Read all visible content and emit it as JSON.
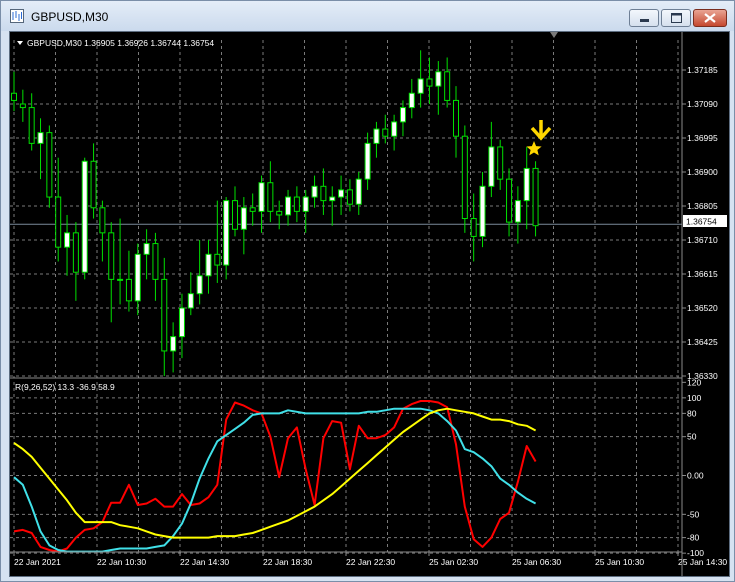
{
  "window": {
    "title": "GBPUSD,M30",
    "icon": "chart-window-icon",
    "buttons": [
      "minimize-icon",
      "maximize-icon",
      "close-icon"
    ]
  },
  "colors": {
    "background": "#000000",
    "grid": "#7a7a7a",
    "candle_up_fill": "#ffffff",
    "candle_down_fill": "#000000",
    "candle_wick": "#00e000",
    "price_line": "#7a8a9a",
    "red_line": "#ff0000",
    "cyan_line": "#40e0e8",
    "yellow_line": "#ffff00",
    "arrow": "#ffd700"
  },
  "price_chart": {
    "header": "GBPUSD,M30  1.36905 1.36926 1.36744 1.36754",
    "price_levels": [
      "1.37185",
      "1.37090",
      "1.36995",
      "1.36900",
      "1.36805",
      "1.36710",
      "1.36615",
      "1.36520",
      "1.36425",
      "1.36330"
    ],
    "current_price": "1.36754"
  },
  "indicator": {
    "header": "R(9,26,52) 13.3 -36.9 58.9",
    "levels": [
      "120",
      "100",
      "80",
      "50",
      "0.00",
      "-50",
      "-80",
      "-100"
    ]
  },
  "time_axis": [
    "22 Jan 2021",
    "22 Jan 10:30",
    "22 Jan 14:30",
    "22 Jan 18:30",
    "22 Jan 22:30",
    "25 Jan 02:30",
    "25 Jan 06:30",
    "25 Jan 10:30",
    "25 Jan 14:30"
  ],
  "chart_data": {
    "type": "candlestick",
    "symbol": "GBPUSD",
    "timeframe": "M30",
    "ylim": [
      1.363,
      1.3732
    ],
    "indicator_ylim": [
      -100,
      120
    ],
    "candles": [
      [
        1.3712,
        1.3718,
        1.3707,
        1.371
      ],
      [
        1.3709,
        1.3713,
        1.3704,
        1.3708
      ],
      [
        1.3708,
        1.3712,
        1.3696,
        1.3698
      ],
      [
        1.3698,
        1.3705,
        1.3688,
        1.3701
      ],
      [
        1.3701,
        1.3703,
        1.368,
        1.3683
      ],
      [
        1.3683,
        1.3694,
        1.3665,
        1.3669
      ],
      [
        1.3669,
        1.3678,
        1.3661,
        1.3673
      ],
      [
        1.3673,
        1.3676,
        1.3654,
        1.3662
      ],
      [
        1.3662,
        1.3694,
        1.366,
        1.3693
      ],
      [
        1.3693,
        1.3698,
        1.3677,
        1.368
      ],
      [
        1.368,
        1.3682,
        1.3665,
        1.3673
      ],
      [
        1.3673,
        1.3676,
        1.3648,
        1.366
      ],
      [
        1.366,
        1.3677,
        1.3653,
        1.366
      ],
      [
        1.366,
        1.3668,
        1.3651,
        1.3654
      ],
      [
        1.3654,
        1.367,
        1.365,
        1.3667
      ],
      [
        1.3667,
        1.3674,
        1.366,
        1.367
      ],
      [
        1.367,
        1.3673,
        1.3654,
        1.366
      ],
      [
        1.366,
        1.3666,
        1.3633,
        1.364
      ],
      [
        1.364,
        1.3648,
        1.3634,
        1.3644
      ],
      [
        1.3644,
        1.3656,
        1.3638,
        1.3652
      ],
      [
        1.3652,
        1.3662,
        1.365,
        1.3656
      ],
      [
        1.3656,
        1.3671,
        1.3653,
        1.3661
      ],
      [
        1.3661,
        1.3671,
        1.3656,
        1.3667
      ],
      [
        1.3667,
        1.3682,
        1.3659,
        1.3664
      ],
      [
        1.3664,
        1.3683,
        1.366,
        1.3682
      ],
      [
        1.3682,
        1.3686,
        1.3672,
        1.3674
      ],
      [
        1.3674,
        1.3683,
        1.3667,
        1.368
      ],
      [
        1.368,
        1.3684,
        1.3675,
        1.3679
      ],
      [
        1.3679,
        1.3689,
        1.3673,
        1.3687
      ],
      [
        1.3687,
        1.3693,
        1.3676,
        1.3679
      ],
      [
        1.3679,
        1.3682,
        1.3674,
        1.3678
      ],
      [
        1.3678,
        1.3685,
        1.3675,
        1.3683
      ],
      [
        1.3683,
        1.3686,
        1.3676,
        1.3679
      ],
      [
        1.3679,
        1.3685,
        1.3673,
        1.3683
      ],
      [
        1.3683,
        1.3689,
        1.368,
        1.3686
      ],
      [
        1.3686,
        1.3691,
        1.3678,
        1.3682
      ],
      [
        1.3682,
        1.3686,
        1.3675,
        1.3683
      ],
      [
        1.3683,
        1.3689,
        1.3678,
        1.3685
      ],
      [
        1.3685,
        1.3688,
        1.3679,
        1.3681
      ],
      [
        1.3681,
        1.369,
        1.3678,
        1.3688
      ],
      [
        1.3688,
        1.3701,
        1.3685,
        1.3698
      ],
      [
        1.3698,
        1.3704,
        1.3694,
        1.3702
      ],
      [
        1.3702,
        1.3706,
        1.3698,
        1.37
      ],
      [
        1.37,
        1.3706,
        1.3696,
        1.3704
      ],
      [
        1.3704,
        1.371,
        1.37,
        1.3708
      ],
      [
        1.3708,
        1.3716,
        1.3705,
        1.3712
      ],
      [
        1.3712,
        1.3724,
        1.3708,
        1.3716
      ],
      [
        1.3716,
        1.3722,
        1.3709,
        1.3714
      ],
      [
        1.3714,
        1.3721,
        1.3706,
        1.3718
      ],
      [
        1.3718,
        1.3722,
        1.3708,
        1.371
      ],
      [
        1.371,
        1.3714,
        1.3694,
        1.37
      ],
      [
        1.37,
        1.3703,
        1.3673,
        1.3677
      ],
      [
        1.3677,
        1.3684,
        1.3665,
        1.3672
      ],
      [
        1.3672,
        1.369,
        1.3669,
        1.3686
      ],
      [
        1.3686,
        1.3704,
        1.3683,
        1.3697
      ],
      [
        1.3697,
        1.3699,
        1.3685,
        1.3688
      ],
      [
        1.3688,
        1.3691,
        1.3672,
        1.3676
      ],
      [
        1.3676,
        1.3686,
        1.367,
        1.3682
      ],
      [
        1.3682,
        1.3697,
        1.3674,
        1.3691
      ],
      [
        1.3691,
        1.3693,
        1.3672,
        1.3675
      ]
    ],
    "series": [
      {
        "name": "R 9",
        "color": "#ff0000",
        "values": [
          -72,
          -70,
          -74,
          -92,
          -96,
          -98,
          -94,
          -80,
          -70,
          -68,
          -60,
          -35,
          -35,
          -12,
          -38,
          -36,
          -30,
          -40,
          -40,
          -24,
          -38,
          -36,
          -28,
          -12,
          72,
          94,
          90,
          84,
          80,
          50,
          -2,
          48,
          62,
          8,
          -38,
          48,
          70,
          68,
          8,
          64,
          48,
          48,
          52,
          62,
          86,
          92,
          96,
          96,
          94,
          88,
          40,
          -40,
          -82,
          -92,
          -80,
          -56,
          -48,
          -8,
          38,
          18
        ]
      },
      {
        "name": "R 26",
        "color": "#40e0e8",
        "values": [
          -2,
          -12,
          -40,
          -72,
          -90,
          -96,
          -98,
          -98,
          -98,
          -98,
          -98,
          -96,
          -94,
          -94,
          -94,
          -94,
          -92,
          -90,
          -78,
          -62,
          -36,
          -4,
          22,
          44,
          52,
          60,
          68,
          78,
          80,
          80,
          80,
          84,
          82,
          80,
          80,
          80,
          80,
          80,
          80,
          80,
          82,
          82,
          84,
          86,
          86,
          86,
          86,
          84,
          80,
          70,
          58,
          34,
          30,
          22,
          12,
          -4,
          -12,
          -22,
          -30,
          -36
        ]
      },
      {
        "name": "R 52",
        "color": "#ffff00",
        "values": [
          42,
          34,
          24,
          10,
          -4,
          -18,
          -32,
          -48,
          -60,
          -60,
          -60,
          -60,
          -64,
          -66,
          -68,
          -72,
          -76,
          -78,
          -80,
          -80,
          -80,
          -80,
          -80,
          -78,
          -78,
          -78,
          -76,
          -74,
          -70,
          -66,
          -62,
          -58,
          -52,
          -46,
          -40,
          -32,
          -24,
          -14,
          -4,
          6,
          16,
          26,
          36,
          46,
          56,
          64,
          72,
          80,
          84,
          86,
          84,
          82,
          80,
          76,
          72,
          72,
          70,
          66,
          64,
          58
        ]
      }
    ]
  }
}
